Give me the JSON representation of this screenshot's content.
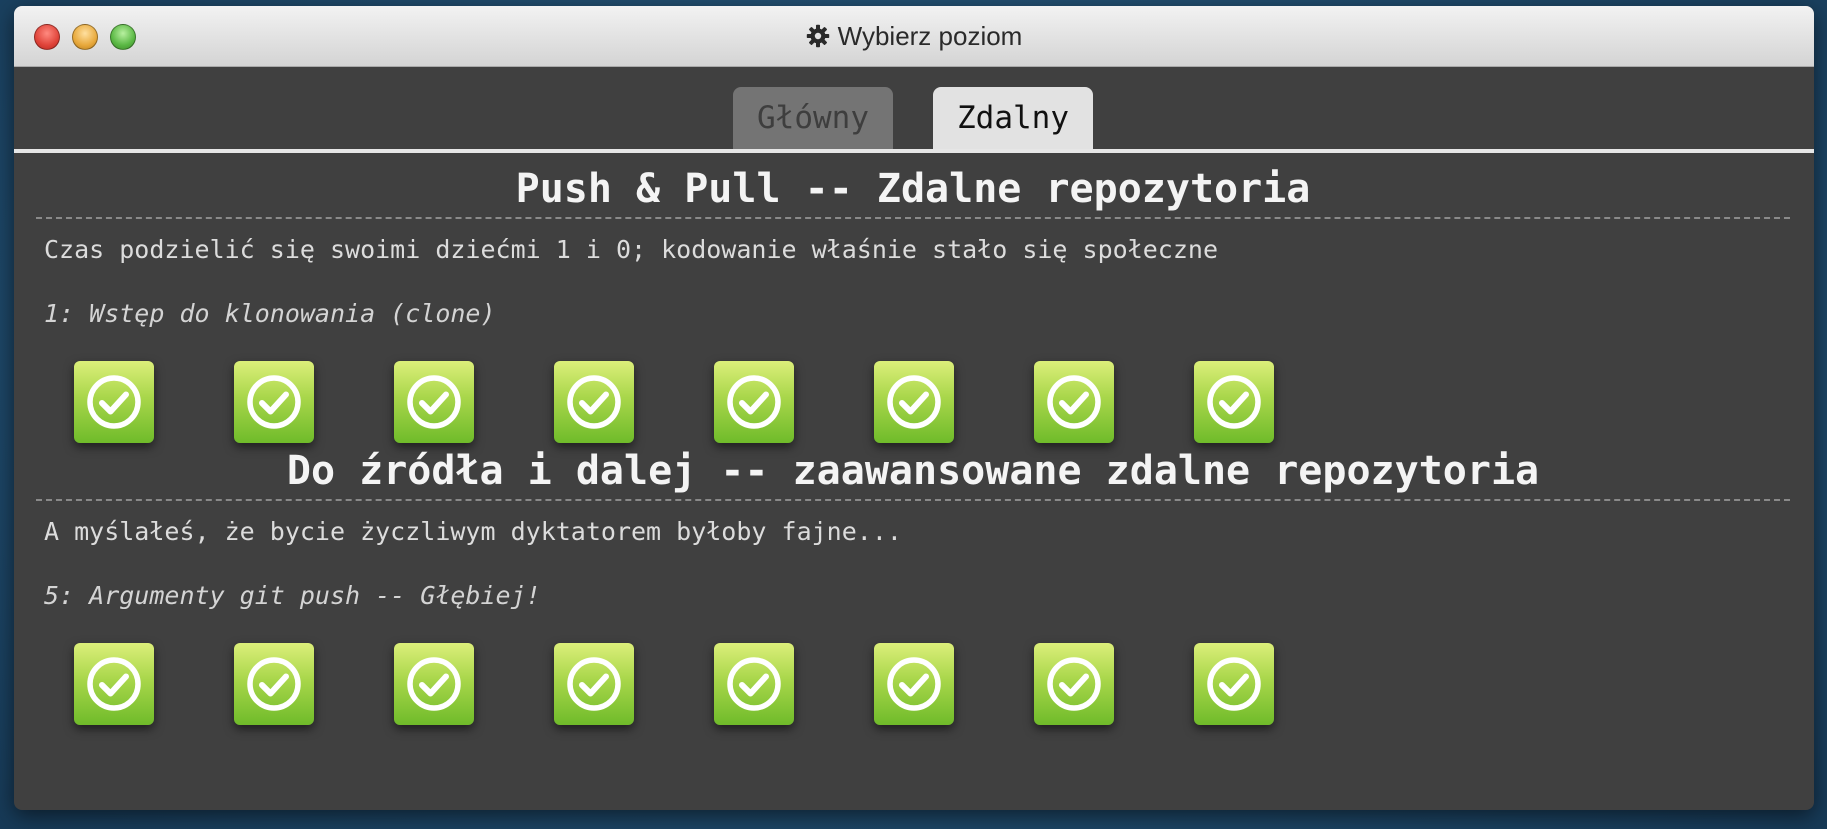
{
  "window": {
    "title": "Wybierz poziom",
    "title_icon": "gear-icon"
  },
  "tabs": [
    {
      "label": "Główny",
      "active": false
    },
    {
      "label": "Zdalny",
      "active": true
    }
  ],
  "sections": [
    {
      "title": "Push & Pull -- Zdalne repozytoria",
      "description": "Czas podzielić się swoimi dziećmi 1 i 0; kodowanie właśnie stało się społeczne",
      "sequence_label": "1: Wstęp do klonowania (clone)",
      "levels_completed": 8
    },
    {
      "title": "Do źródła i dalej -- zaawansowane zdalne repozytoria",
      "description": "A myślałeś, że bycie życzliwym dyktatorem byłoby fajne...",
      "sequence_label": "5: Argumenty git push -- Głębiej!",
      "levels_completed": 8
    }
  ],
  "colors": {
    "background": "#404040",
    "level_complete": "#6fbb2a"
  }
}
